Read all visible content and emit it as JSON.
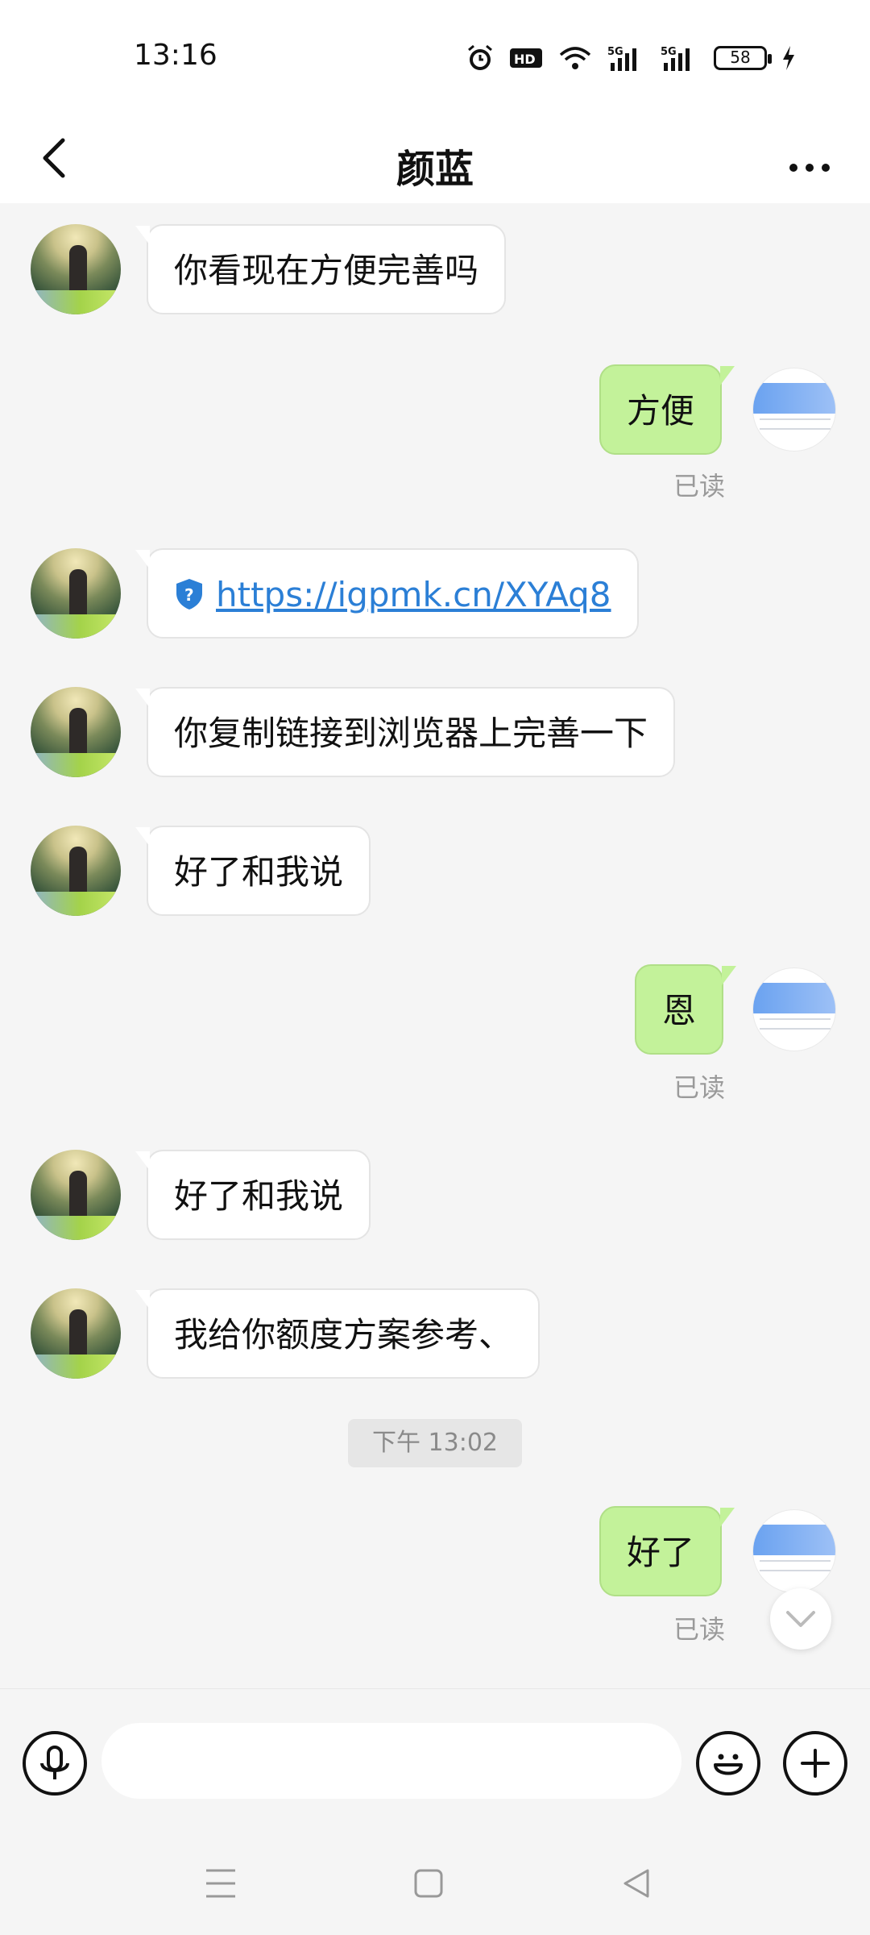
{
  "status_bar": {
    "time": "13:16",
    "battery": "58"
  },
  "header": {
    "title": "颜蓝"
  },
  "messages": {
    "m1": "你看现在方便完善吗",
    "m2": "方便",
    "m3_link": "https://igpmk.cn/XYAq8",
    "m4": "你复制链接到浏览器上完善一下",
    "m5": "好了和我说",
    "m6": "恩",
    "m7": "好了和我说",
    "m8": "我给你额度方案参考、",
    "time_divider": "下午 13:02",
    "m9": "好了"
  },
  "read_label": "已读",
  "colors": {
    "out_bubble": "#c3f29a",
    "link": "#2b7fd6",
    "background": "#f5f5f5"
  }
}
